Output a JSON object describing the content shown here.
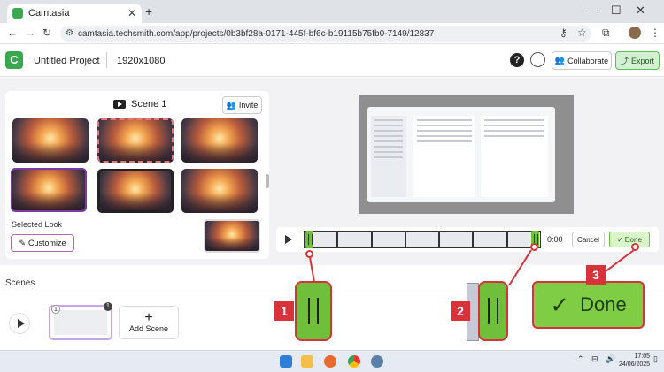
{
  "browser": {
    "tab_title": "Camtasia",
    "url": "camtasia.techsmith.com/app/projects/0b3bf28a-0171-445f-bf6c-b19115b75fb0-7149/12837"
  },
  "header": {
    "project_title": "Untitled Project",
    "resolution": "1920x1080",
    "collaborate_label": "Collaborate",
    "export_label": "Export"
  },
  "scene_panel": {
    "title": "Scene 1",
    "invite_label": "Invite",
    "selected_look_label": "Selected Look",
    "customize_label": "Customize"
  },
  "trim": {
    "time": "0:00",
    "cancel_label": "Cancel",
    "done_label": "Done"
  },
  "scenes": {
    "label": "Scenes",
    "add_scene_label": "Add Scene",
    "badge_left": "1",
    "badge_right": "1"
  },
  "callouts": [
    {
      "number": "1"
    },
    {
      "number": "2"
    },
    {
      "number": "3",
      "label": "Done"
    }
  ],
  "taskbar": {
    "time": "17:05",
    "date": "24/06/2025"
  },
  "colors": {
    "accent_green": "#6fbf3a",
    "callout_red": "#d8323a"
  }
}
